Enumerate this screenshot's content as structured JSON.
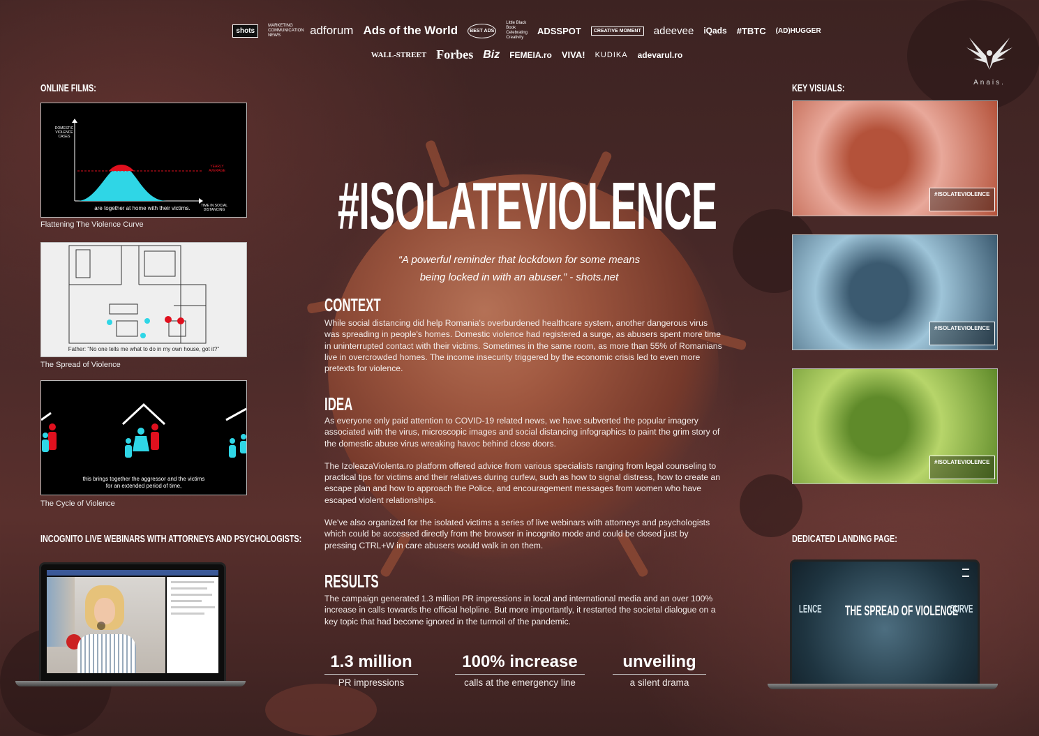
{
  "logos": {
    "row1": [
      "shots",
      "MARKETING COMMUNICATION NEWS",
      "adforum",
      "Ads of the World",
      "BEST ADS",
      "Little Black Book Celebrating Creativity",
      "ADSSPOT",
      "CREATIVE MOMENT",
      "adeevee",
      "iQads",
      "#TBTC",
      "(AD)HUGGER"
    ],
    "row2": [
      "WALL-STREET",
      "Forbes",
      "Biz",
      "FEMEIA.ro",
      "VIVA!",
      "KUDIKA",
      "adevarul.ro"
    ]
  },
  "brand": {
    "name": "Anais."
  },
  "left": {
    "online_films_heading": "ONLINE FILMS:",
    "films": [
      {
        "caption": "Flattening The Violence Curve",
        "y_axis": "DOMESTIC VIOLENCE CASES",
        "yearly": "YEARLY AVERAGE",
        "x_axis": "TIME IN SOCIAL DISTANCING",
        "subtitle": "are together at home with their victims."
      },
      {
        "caption": "The Spread of Violence",
        "subtitle": "Father: \"No one tells me what to do in my own house, got it?\""
      },
      {
        "caption": "The Cycle of Violence",
        "subtitle_1": "this brings together the aggressor and the victims",
        "subtitle_2": "for an extended period of time,"
      }
    ],
    "webinars_heading": "INCOGNITO LIVE WEBINARS WITH ATTORNEYS AND PSYCHOLOGISTS:"
  },
  "right": {
    "key_visuals_heading": "KEY VISUALS:",
    "visual_tag": "#ISOLATEVIOLENCE",
    "visuals": [
      {
        "color_a": "#e8a89a",
        "color_b": "#b4523a"
      },
      {
        "color_a": "#9ec4d8",
        "color_b": "#3b5a70"
      },
      {
        "color_a": "#b7d56a",
        "color_b": "#5f8a2a"
      }
    ],
    "landing_heading": "DEDICATED LANDING PAGE:",
    "landing_title": "THE SPREAD OF VIOLENCE",
    "landing_left": "LENCE",
    "landing_right": "CURVE"
  },
  "main": {
    "title": "#ISOLATEVIOLENCE",
    "quote_line1": "“A powerful reminder that lockdown for some means",
    "quote_line2": "being locked in with an abuser.”",
    "quote_source": "- shots.net",
    "context_heading": "CONTEXT",
    "context_body": "While social distancing did help Romania's overburdened healthcare system, another dangerous virus was spreading in people's homes. Domestic violence had registered a surge, as abusers spent more time in uninterrupted contact with their victims. Sometimes in the same room, as more than 55% of Romanians live in overcrowded homes. The income insecurity triggered by the economic crisis led to even more pretexts for violence.",
    "idea_heading": "IDEA",
    "idea_body_1": "As everyone only paid attention to COVID-19 related news, we have subverted the popular imagery associated with the virus, microscopic images and social distancing infographics to paint the grim story of the domestic abuse virus wreaking havoc behind close doors.",
    "idea_body_2": "The IzoleazaViolenta.ro platform offered advice from various specialists ranging from legal counseling to practical tips for victims and their relatives during curfew, such as how to signal distress, how to create an escape plan and how to approach the Police, and encouragement messages from women who have escaped violent relationships.",
    "idea_body_3": "We've also organized for the isolated victims a series of live webinars with attorneys and psychologists which could be accessed directly from the browser in incognito mode and could be closed just by pressing CTRL+W in care abusers would walk in on them.",
    "results_heading": "RESULTS",
    "results_body": "The campaign generated 1.3 million PR impressions in local and international media and an over 100% increase in calls towards the official helpline. But more importantly, it restarted the societal dialogue on a key topic that had become ignored in the turmoil of the pandemic.",
    "stats": [
      {
        "value": "1.3 million",
        "label": "PR impressions"
      },
      {
        "value": "100% increase",
        "label": "calls at the emergency line"
      },
      {
        "value": "unveiling",
        "label": "a silent drama"
      }
    ]
  },
  "colors": {
    "accent_red": "#e0101e",
    "accent_cyan": "#2fd6e6"
  }
}
